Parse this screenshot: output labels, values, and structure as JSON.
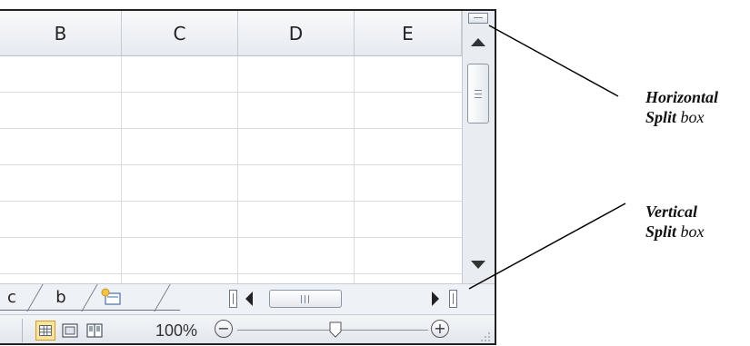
{
  "columns": [
    "B",
    "C",
    "D",
    "E"
  ],
  "sheet_tabs": [
    "c",
    "b"
  ],
  "status_bar": {
    "zoom_level": "100%",
    "zoom_minus": "−",
    "zoom_plus": "+"
  },
  "callouts": {
    "horizontal_split": {
      "bold": "Horizontal",
      "bold2": "Split",
      "rest": "box"
    },
    "vertical_split": {
      "bold": "Vertical",
      "bold2": "Split",
      "rest": "box"
    }
  },
  "colors": {
    "frame_border": "#222222",
    "header_bg": "#e6eaf0",
    "gridline": "#d9dde3",
    "active_view": "#fbe39a"
  },
  "icons": [
    "horizontal-split-box-icon",
    "vertical-split-box-icon",
    "scroll-up-icon",
    "scroll-down-icon",
    "scroll-left-icon",
    "scroll-right-icon",
    "new-sheet-icon",
    "normal-view-icon",
    "page-layout-view-icon",
    "page-break-preview-icon",
    "zoom-out-icon",
    "zoom-in-icon",
    "resize-grip-icon"
  ]
}
